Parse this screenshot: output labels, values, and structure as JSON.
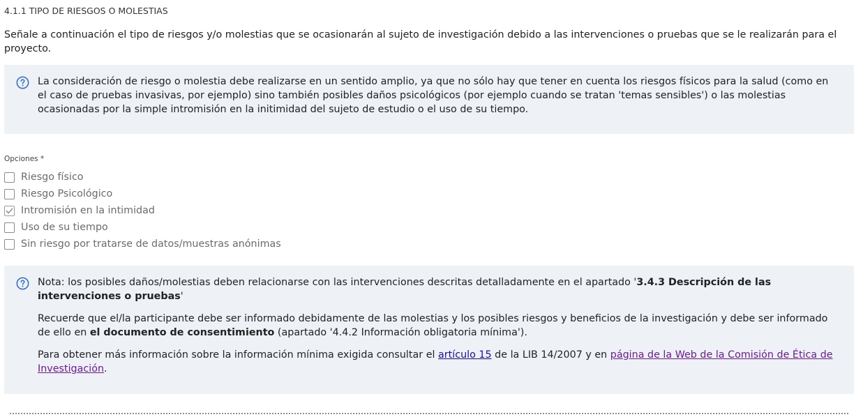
{
  "section": {
    "title": "4.1.1 TIPO DE RIESGOS O MOLESTIAS",
    "intro": "Señale a continuación el tipo de riesgos y/o molestias que se ocasionarán al sujeto de investigación debido a las intervenciones o pruebas que se le realizarán para el proyecto."
  },
  "info_box_1": {
    "icon": "help-circle-icon",
    "text": "La consideración de riesgo o molestia debe realizarse en un sentido amplio, ya que no sólo hay que tener en cuenta los riesgos físicos para la salud (como en el caso de pruebas invasivas, por ejemplo) sino también posibles daños psicológicos (por ejemplo cuando se tratan 'temas sensibles') o las molestias ocasionadas por la simple intromisión en la initimidad del sujeto de estudio o el uso de su tiempo."
  },
  "options": {
    "label": "Opciones *",
    "items": [
      {
        "label": "Riesgo físico",
        "checked": false
      },
      {
        "label": "Riesgo Psicológico",
        "checked": false
      },
      {
        "label": "Intromisión en la intimidad",
        "checked": true
      },
      {
        "label": "Uso de su tiempo",
        "checked": false
      },
      {
        "label": "Sin riesgo por tratarse de datos/muestras anónimas",
        "checked": false
      }
    ]
  },
  "info_box_2": {
    "icon": "help-circle-icon",
    "p1_prefix": "Nota: los posibles daños/molestias deben relacionarse con las intervenciones descritas detalladamente en el apartado '",
    "p1_bold": "3.4.3 Descripción de las intervenciones o pruebas",
    "p1_suffix": "'",
    "p2_prefix": "Recuerde que el/la participante debe ser informado debidamente de las molestias y los posibles riesgos y beneficios de la investigación y debe ser informado de ello en ",
    "p2_bold": "el documento de consentimiento",
    "p2_suffix": " (apartado '4.4.2 Información obligatoria mínima').",
    "p3_prefix": "Para obtener más información sobre la información mínima exigida consultar el ",
    "p3_link1": "artículo 15",
    "p3_middle": " de la LIB 14/2007 y en ",
    "p3_link2": "página de la Web de la Comisión de Ética de Investigación",
    "p3_suffix": "."
  },
  "colors": {
    "box_background": "#eef1f5",
    "icon_blue": "#2d6ec8",
    "link_blue": "#1a0dab",
    "link_visited": "#6a1b9a"
  }
}
